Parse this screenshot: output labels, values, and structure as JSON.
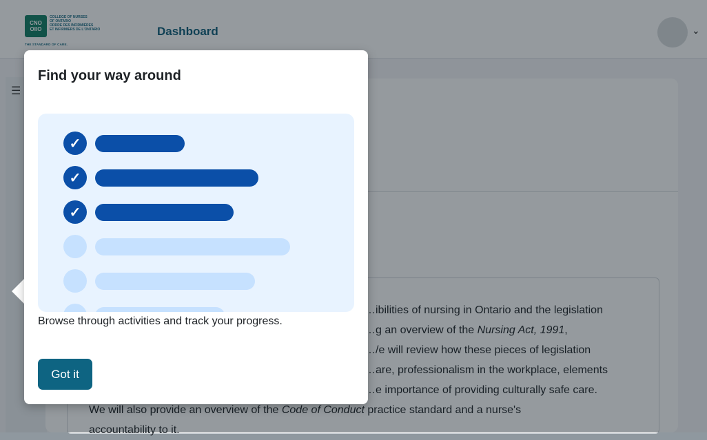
{
  "header": {
    "logo_lines": [
      "COLLEGE OF NURSES",
      "OF ONTARIO",
      "ORDRE DES INFIRMIÈRES",
      "ET INFIRMIERS DE L'ONTARIO"
    ],
    "logo_tagline": "THE STANDARD OF CARE.",
    "nav_title": "Dashboard",
    "avatar_icon": "user-avatar",
    "menu_caret_icon": "chevron-down-icon"
  },
  "sidebar": {
    "toggle_icon": "list-icon"
  },
  "course": {
    "description_parts": [
      "…ibilities of nursing in Ontario and the legislation",
      "…g an overview of the ",
      "Nursing Act, 1991",
      ",",
      "…/e will review how these pieces of legislation",
      "…are, professionalism in the workplace, elements",
      "…e importance of providing culturally safe care.",
      "We will also provide an overview of the ",
      "Code of Conduct",
      " practice standard and a nurse's",
      "accountability to it."
    ]
  },
  "tour": {
    "title": "Find your way around",
    "body": "Browse through activities and track your progress.",
    "button_label": "Got it",
    "illustration_items": [
      {
        "completed": true
      },
      {
        "completed": true
      },
      {
        "completed": true
      },
      {
        "completed": false
      },
      {
        "completed": false
      },
      {
        "completed": false
      }
    ]
  },
  "colors": {
    "brand_blue": "#0b4fa8",
    "button_teal": "#0e6482",
    "illustration_bg": "#e8f3ff",
    "pending_item": "#c6e1ff"
  }
}
